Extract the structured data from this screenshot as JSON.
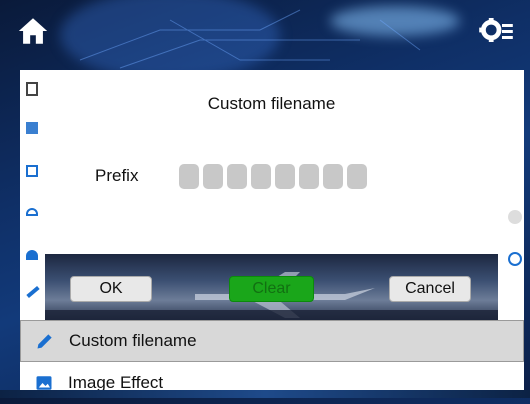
{
  "header": {
    "home_icon": "home-icon",
    "settings_icon": "settings-gear-icon"
  },
  "menu": {
    "items": [
      {
        "label": "Custom filename",
        "icon": "pencil-icon",
        "selected": true
      },
      {
        "label": "Image Effect",
        "icon": "image-icon",
        "selected": false
      }
    ]
  },
  "dialog": {
    "title": "Custom filename",
    "prefix_label": "Prefix",
    "prefix_slots": 8,
    "ok_label": "OK",
    "clear_label": "Clear",
    "cancel_label": "Cancel"
  },
  "colors": {
    "accent_blue": "#1a6fd0",
    "clear_green": "#1aa61a"
  }
}
